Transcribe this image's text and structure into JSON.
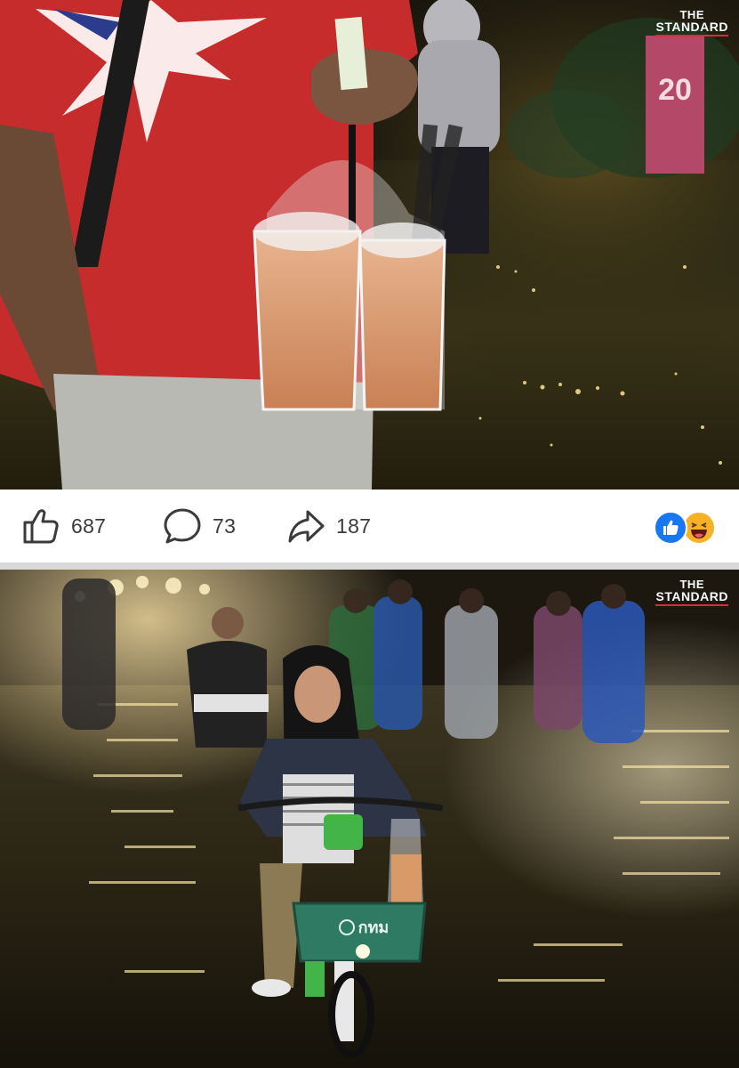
{
  "post_photos": [
    {
      "alt_name": "flood-photo-drinks",
      "watermark": {
        "line1": "THE",
        "line2": "STANDARD"
      },
      "sign_text": "20"
    },
    {
      "alt_name": "flood-photo-bicycle",
      "watermark": {
        "line1": "THE",
        "line2": "STANDARD"
      },
      "basket_text": "กทม"
    }
  ],
  "actions": {
    "like": {
      "icon": "thumbs-up-icon",
      "count": "687"
    },
    "comment": {
      "icon": "comment-bubble-icon",
      "count": "73"
    },
    "share": {
      "icon": "share-arrow-icon",
      "count": "187"
    }
  },
  "reactions": [
    {
      "icon": "like-reaction-icon",
      "color": "#1877f2"
    },
    {
      "icon": "haha-reaction-icon",
      "color": "#f7b125"
    }
  ],
  "colors": {
    "watermark_accent": "#e4263a",
    "icon_gray": "#3a3b3c",
    "separator": "#d9d9d9"
  }
}
